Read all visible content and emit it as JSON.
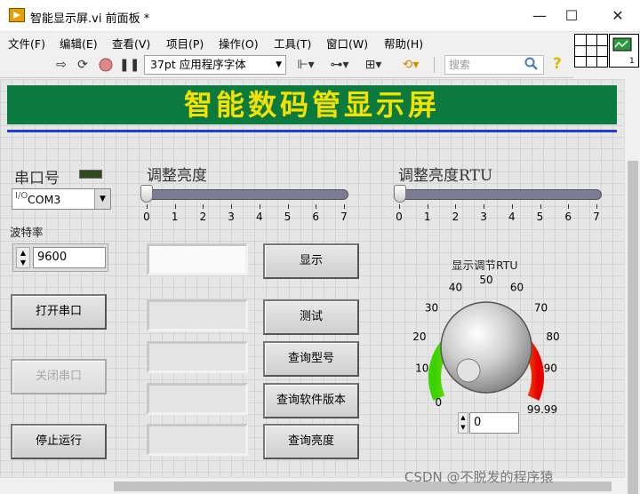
{
  "window": {
    "title": "智能显示屏.vi 前面板 *",
    "minimize_glyph": "—",
    "maximize_glyph": "☐",
    "close_glyph": "✕"
  },
  "menu": [
    "文件(F)",
    "编辑(E)",
    "查看(V)",
    "项目(P)",
    "操作(O)",
    "工具(T)",
    "窗口(W)",
    "帮助(H)"
  ],
  "toolbar": {
    "font": "37pt 应用程序字体",
    "search_placeholder": "搜索",
    "icons": [
      "run-arrow-icon",
      "run-continuously-icon",
      "abort-icon",
      "pause-icon",
      "align-icon",
      "distribute-icon",
      "resize-icon",
      "reorder-icon",
      "search-icon",
      "help-icon"
    ]
  },
  "panel": {
    "banner_title": "智能数码管显示屏",
    "banner_color": "#0b7a3e",
    "banner_text_color": "#f5e100",
    "serial": {
      "label": "串口号",
      "radix": "I/O",
      "value": "COM3"
    },
    "baud": {
      "label": "波特率",
      "value": "9600"
    },
    "buttons": {
      "open": "打开串口",
      "close": "关闭串口",
      "stop": "停止运行",
      "show": "显示",
      "test": "测试",
      "query_model": "查询型号",
      "query_version": "查询软件版本",
      "query_brightness": "查询亮度"
    },
    "slider1": {
      "label": "调整亮度",
      "ticks": [
        "0",
        "1",
        "2",
        "3",
        "4",
        "5",
        "6",
        "7"
      ],
      "value": 0
    },
    "slider2": {
      "label": "调整亮度RTU",
      "ticks": [
        "0",
        "1",
        "2",
        "3",
        "4",
        "5",
        "6",
        "7"
      ],
      "value": 0
    },
    "knob": {
      "label": "显示调节RTU",
      "scale": [
        "0",
        "10",
        "20",
        "30",
        "40",
        "50",
        "60",
        "70",
        "80",
        "90",
        "99.99"
      ],
      "value": "0"
    }
  },
  "watermark": "CSDN @不脱发的程序猿"
}
